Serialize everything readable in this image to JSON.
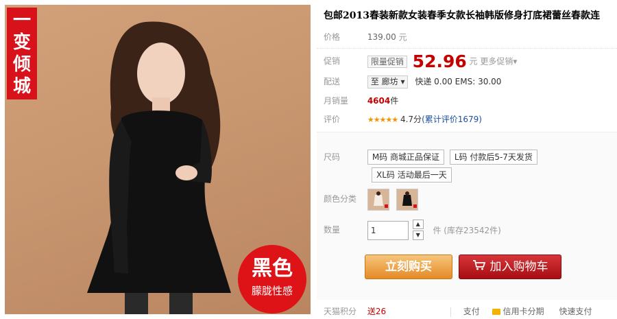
{
  "photo": {
    "corner_tag": [
      "一",
      "变",
      "倾",
      "城"
    ],
    "badge_big": "黑色",
    "badge_small": "朦胧性感"
  },
  "product": {
    "title": "包邮2013春装新款女装春季女款长袖韩版修身打底裙蕾丝春款连",
    "price_label": "价格",
    "price_value": "139.00",
    "yuan": "元",
    "promo_label": "促销",
    "promo_tag": "限量促销",
    "promo_price": "52.96",
    "more_promo": "更多促销▾",
    "ship_label": "配送",
    "ship_to": "至 廊坊 ▾",
    "ship_info": "快递 0.00 EMS: 30.00",
    "monthly_label": "月销量",
    "monthly_count": "4604",
    "monthly_unit": "件",
    "rating_label": "评价",
    "stars": "★★★★★",
    "rating_score": "4.7分",
    "rating_count": "(累计评价1679)"
  },
  "sku": {
    "size_label": "尺码",
    "sizes": [
      "M码 商城正品保证",
      "L码 付款后5-7天发货",
      "XL码 活动最后一天"
    ],
    "color_label": "颜色分类",
    "qty_label": "数量",
    "qty_value": "1",
    "stock": "件 (库存23542件)"
  },
  "actions": {
    "buy_now": "立刻购买",
    "add_cart": "加入购物车"
  },
  "bottom": {
    "points_label": "天猫积分",
    "points_value": "送26",
    "pay_label": "支付",
    "credit_card": "信用卡分期",
    "quick_pay": "快速支付"
  }
}
